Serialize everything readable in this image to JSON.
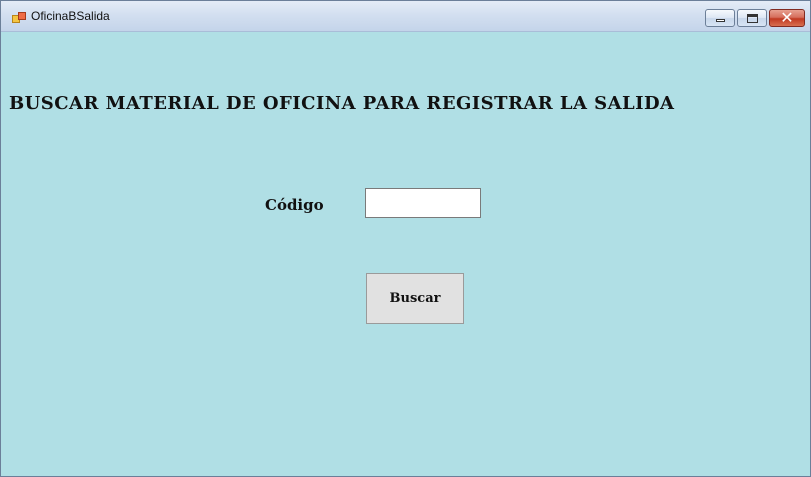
{
  "window": {
    "title": "OficinaBSalida",
    "app_icon": "form-app-icon",
    "controls": [
      "minimize-icon",
      "maximize-icon",
      "close-icon"
    ],
    "close_glyph": "✕"
  },
  "form": {
    "heading": "BUSCAR MATERIAL DE OFICINA PARA REGISTRAR LA SALIDA",
    "code_label": "Código",
    "code_value": "",
    "search_button": "Buscar"
  },
  "colors": {
    "form_background": "#b0dfe5",
    "button_background": "#e1e1e1",
    "close_button": "#c13a22"
  }
}
